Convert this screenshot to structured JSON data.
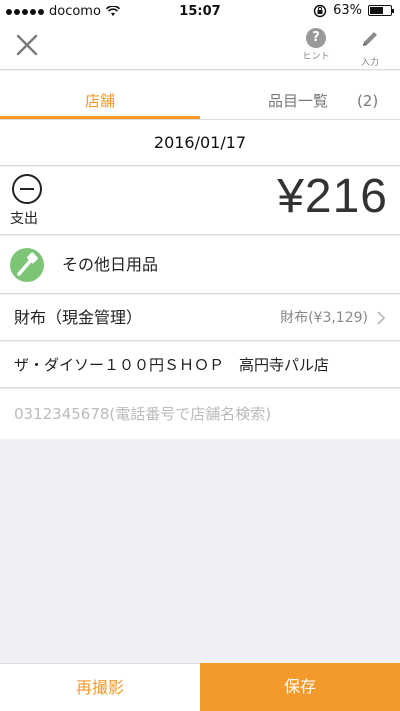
{
  "status_bar": {
    "carrier": "docomo",
    "time": "15:07",
    "battery": "63%",
    "battery_level": 0.63
  },
  "nav": {
    "hint_label": "ヒント",
    "input_label": "入力"
  },
  "tabs": {
    "shop": "店舗",
    "items": "品目一覧",
    "items_count": "(2)"
  },
  "receipt": {
    "date": "2016/01/17",
    "type_label": "支出",
    "amount": "¥216",
    "category": "その他日用品",
    "wallet_label": "財布（現金管理）",
    "wallet_value": "財布(¥3,129)",
    "shop_name": "ザ・ダイソー１００円ＳＨＯＰ　高円寺パル店",
    "search_placeholder": "0312345678(電話番号で店舗名検索)"
  },
  "buttons": {
    "retake": "再撮影",
    "save": "保存"
  },
  "colors": {
    "accent": "#f39a2b",
    "category_icon_bg": "#7cc576"
  },
  "icons": [
    "close-icon",
    "hint-icon",
    "pencil-icon",
    "minus-circle-icon",
    "toothbrush-icon",
    "chevron-right-icon",
    "wifi-icon",
    "lock-rotation-icon",
    "battery-icon"
  ]
}
